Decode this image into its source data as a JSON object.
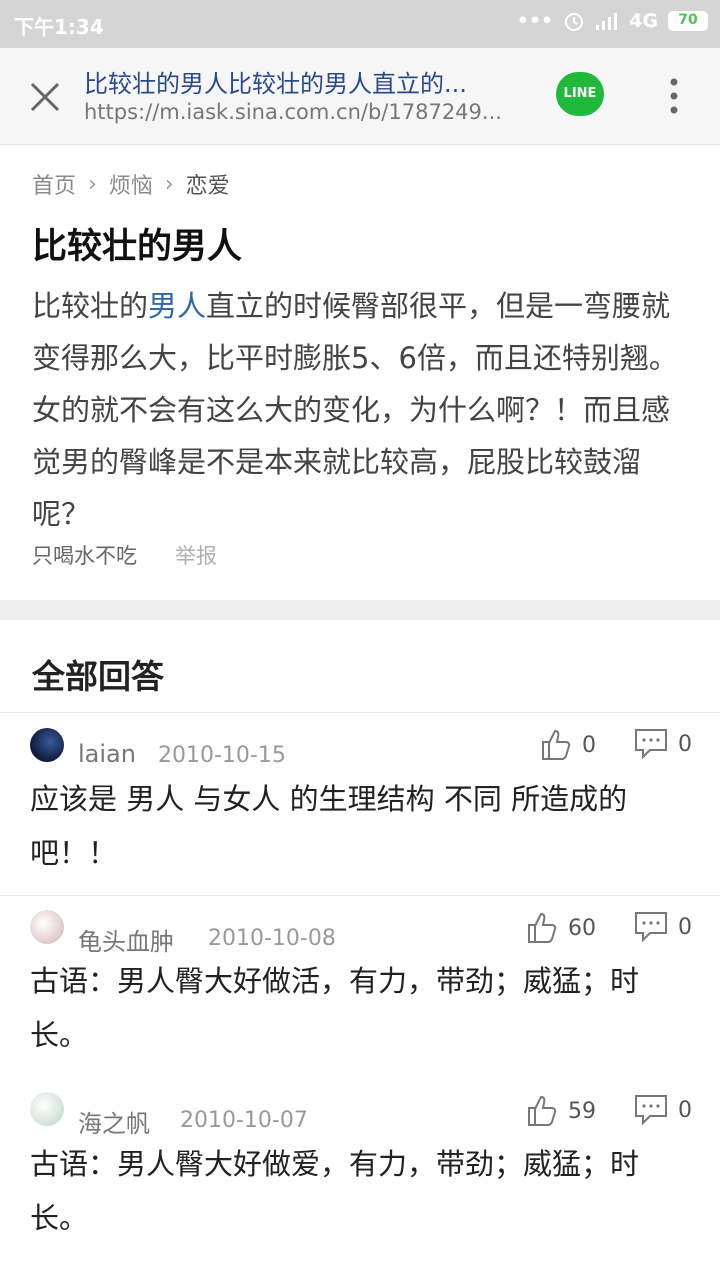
{
  "status_bar": {
    "time": "下午1:34",
    "network": "4G",
    "battery": "70"
  },
  "url_bar": {
    "title": "比较壮的男人比较壮的男人直立的...",
    "url": "https://m.iask.sina.com.cn/b/1787249...",
    "line_label": "LINE"
  },
  "breadcrumb": [
    "首页",
    "烦恼",
    "恋爱"
  ],
  "question": {
    "title": "比较壮的男人",
    "body_before": "比较壮的",
    "body_link": "男人",
    "body_after": "直立的时候臀部很平，但是一弯腰就变得那么大，比平时膨胀5、6倍，而且还特别翘。女的就不会有这么大的变化，为什么啊？！而且感觉男的臀峰是不是本来就比较高，屁股比较鼓溜呢？",
    "author": "只喝水不吃",
    "report": "举报"
  },
  "answers_header": "全部回答",
  "answers": [
    {
      "user": "laian",
      "date": "2010-10-15",
      "likes": "0",
      "comments": "0",
      "text": "应该是 男人 与女人  的生理结构 不同  所造成的吧！！"
    },
    {
      "user": "龟头血肿",
      "date": "2010-10-08",
      "likes": "60",
      "comments": "0",
      "text": "古语：男人臀大好做活，有力，带劲；威猛；时长。"
    },
    {
      "user": "海之帆",
      "date": "2010-10-07",
      "likes": "59",
      "comments": "0",
      "text": "古语：男人臀大好做爱，有力，带劲；威猛；时长。"
    }
  ],
  "colors": {
    "link": "#2f67a9",
    "line_green": "#1fb93c",
    "status_bg": "#d5d5d5"
  }
}
